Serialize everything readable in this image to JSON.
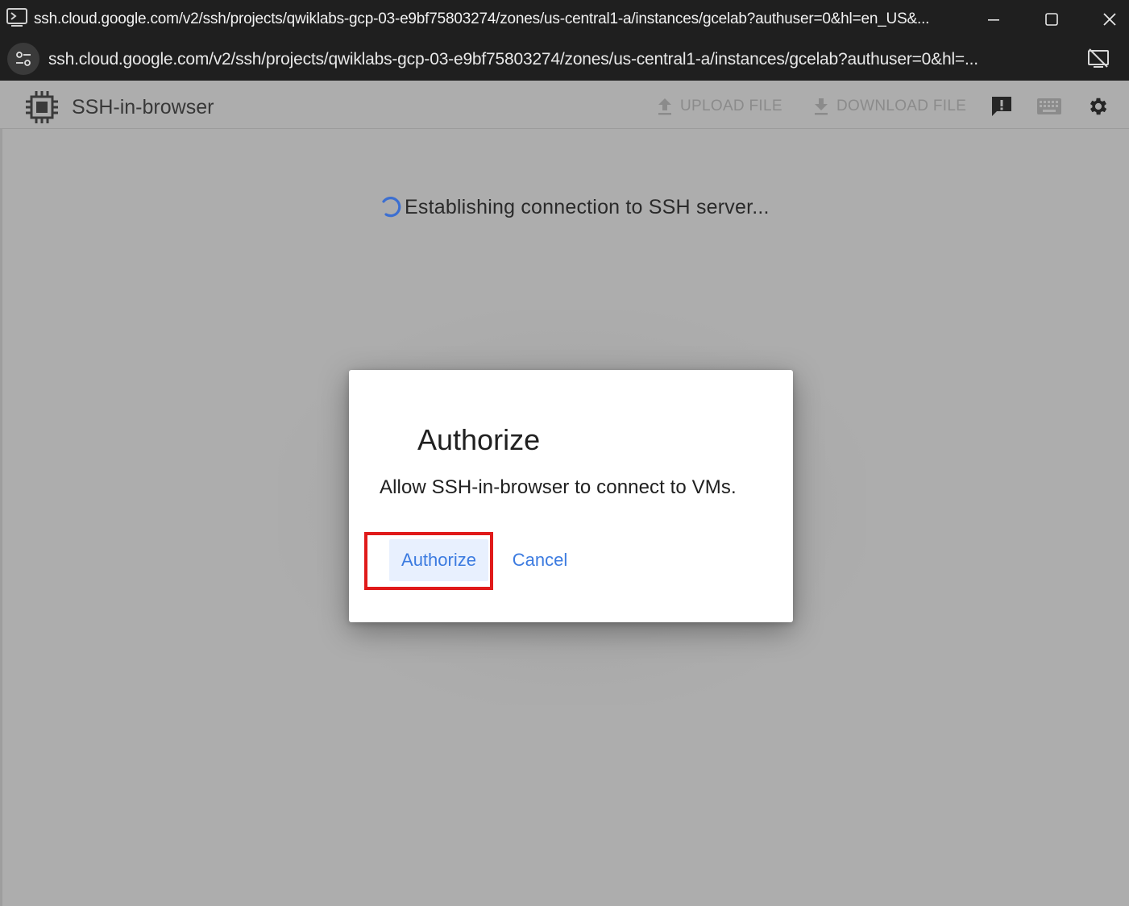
{
  "window": {
    "title": "ssh.cloud.google.com/v2/ssh/projects/qwiklabs-gcp-03-e9bf75803274/zones/us-central1-a/instances/gcelab?authuser=0&hl=en_US&...",
    "icon": "terminal-window-icon",
    "controls": {
      "minimize_icon": "minimize-icon",
      "maximize_icon": "maximize-icon",
      "close_icon": "close-icon"
    }
  },
  "address_bar": {
    "url": "ssh.cloud.google.com/v2/ssh/projects/qwiklabs-gcp-03-e9bf75803274/zones/us-central1-a/instances/gcelab?authuser=0&hl=...",
    "site_info_icon": "site-settings-icon",
    "right_icon": "tracking-protection-icon"
  },
  "toolbar": {
    "app_title": "SSH-in-browser",
    "app_icon": "chip-icon",
    "upload_label": "UPLOAD FILE",
    "download_label": "DOWNLOAD FILE",
    "feedback_icon": "feedback-icon",
    "keyboard_icon": "keyboard-icon",
    "settings_icon": "gear-icon"
  },
  "status": {
    "text": "Establishing connection to SSH server...",
    "spinner_color": "#3c6fd1"
  },
  "dialog": {
    "title": "Authorize",
    "body": "Allow SSH-in-browser to connect to VMs.",
    "primary_button": "Authorize",
    "secondary_button": "Cancel",
    "accent_color": "#3c7be0",
    "highlight_color": "#e01a1a"
  }
}
